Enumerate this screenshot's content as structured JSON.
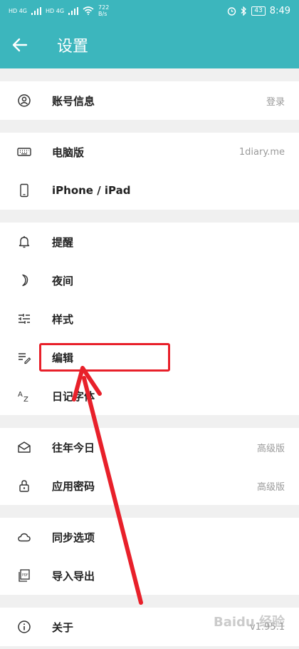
{
  "status": {
    "left_a": "HD 4G",
    "left_b": "HD 4G",
    "speed_value": "722",
    "speed_unit": "B/s",
    "battery": "43",
    "time": "8:49"
  },
  "appbar": {
    "title": "设置"
  },
  "groups": [
    {
      "items": [
        {
          "icon": "account-circle-icon",
          "label": "账号信息",
          "value": "登录"
        }
      ]
    },
    {
      "items": [
        {
          "icon": "keyboard-icon",
          "label": "电脑版",
          "value": "1diary.me"
        },
        {
          "icon": "phone-icon",
          "label": "iPhone / iPad",
          "value": ""
        }
      ]
    },
    {
      "items": [
        {
          "icon": "bell-icon",
          "label": "提醒",
          "value": ""
        },
        {
          "icon": "moon-icon",
          "label": "夜间",
          "value": ""
        },
        {
          "icon": "sliders-icon",
          "label": "样式",
          "value": ""
        },
        {
          "icon": "edit-lines-icon",
          "label": "编辑",
          "value": ""
        },
        {
          "icon": "font-az-icon",
          "label": "日记字体",
          "value": ""
        }
      ]
    },
    {
      "items": [
        {
          "icon": "mail-open-icon",
          "label": "往年今日",
          "value": "高级版"
        },
        {
          "icon": "lock-icon",
          "label": "应用密码",
          "value": "高级版"
        }
      ]
    },
    {
      "items": [
        {
          "icon": "cloud-icon",
          "label": "同步选项",
          "value": ""
        },
        {
          "icon": "pdf-file-icon",
          "label": "导入导出",
          "value": ""
        }
      ]
    },
    {
      "items": [
        {
          "icon": "info-icon",
          "label": "关于",
          "value": "v1.95.1"
        }
      ]
    }
  ],
  "annotation": {
    "highlight_color": "#e8202a"
  },
  "theme": {
    "accent": "#3cb6bd"
  },
  "watermark": "Baidu 经验"
}
